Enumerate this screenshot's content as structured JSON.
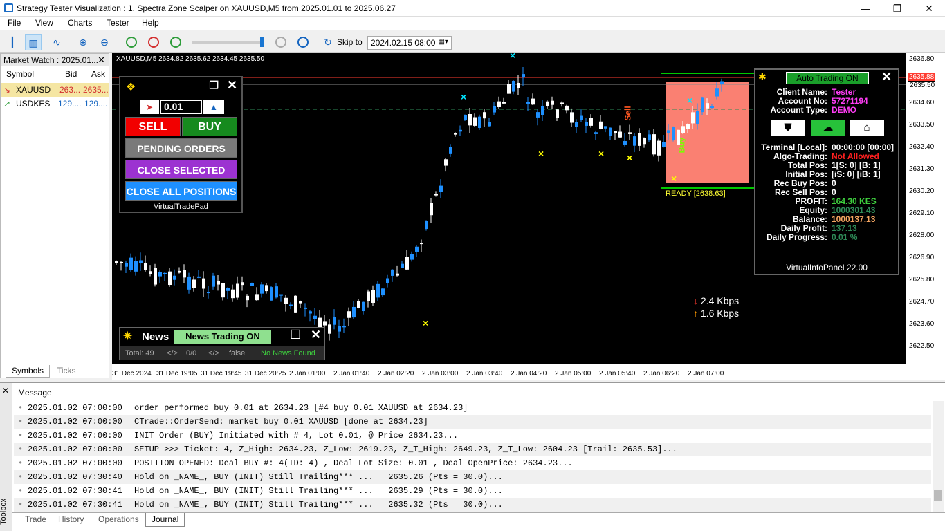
{
  "window": {
    "title": "Strategy Tester Visualization : 1. Spectra Zone Scalper on XAUUSD,M5 from 2025.01.01 to 2025.06.27",
    "min": "—",
    "max": "❐",
    "close": "✕"
  },
  "menu": [
    "File",
    "View",
    "Charts",
    "Tester",
    "Help"
  ],
  "toolbar": {
    "skip_to": "Skip to",
    "date": "2024.02.15 08:00"
  },
  "market_watch": {
    "title": "Market Watch : 2025.01...",
    "columns": [
      "Symbol",
      "Bid",
      "Ask"
    ],
    "rows": [
      {
        "symbol": "XAUUSD",
        "bid": "263...",
        "ask": "2635..."
      },
      {
        "symbol": "USDKES",
        "bid": "129....",
        "ask": "129...."
      }
    ],
    "tabs": [
      "Symbols",
      "Ticks"
    ]
  },
  "chart": {
    "header": "XAUUSD,M5  2634.82 2635.62 2634.45 2635.50",
    "ready": "READY [2638.63]",
    "sell_tag": "Sell",
    "buy_tag": "Buy",
    "net_down": "2.4 Kbps",
    "net_up": "1.6 Kbps",
    "y_ticks": [
      "2636.80",
      "2635.50",
      "2634.60",
      "2633.50",
      "2632.40",
      "2631.30",
      "2630.20",
      "2629.10",
      "2628.00",
      "2626.90",
      "2625.80",
      "2624.70",
      "2623.60",
      "2622.50"
    ],
    "price_tags": [
      "2635.88",
      "2635.50"
    ],
    "x_ticks": [
      "31 Dec 2024",
      "31 Dec 19:05",
      "31 Dec 19:45",
      "31 Dec 20:25",
      "2 Jan 01:00",
      "2 Jan 01:40",
      "2 Jan 02:20",
      "2 Jan 03:00",
      "2 Jan 03:40",
      "2 Jan 04:20",
      "2 Jan 05:00",
      "2 Jan 05:40",
      "2 Jan 06:20",
      "2 Jan 07:00"
    ],
    "colors": {
      "bull": "#1e90ff",
      "bear": "#ffffff",
      "zone": "#fa8072",
      "marker": "#ffff00"
    }
  },
  "vtp": {
    "lot": "0.01",
    "sell": "SELL",
    "buy": "BUY",
    "pending": "PENDING ORDERS",
    "close_selected": "CLOSE SELECTED",
    "close_all": "CLOSE ALL POSITIONS",
    "footer": "VirtualTradePad"
  },
  "vip": {
    "auto": "Auto Trading ON",
    "rows1": [
      {
        "label": "Client Name:",
        "value": "Tester"
      },
      {
        "label": "Account No:",
        "value": "57271194"
      },
      {
        "label": "Account Type:",
        "value": "DEMO"
      }
    ],
    "rows2": [
      {
        "label": "Terminal [Local]:",
        "value": "00:00:00 [00:00]"
      },
      {
        "label": "Algo-Trading:",
        "value": "Not Allowed"
      },
      {
        "label": "Total Pos:",
        "value": "1[S: 0] [B: 1]"
      },
      {
        "label": "Initial Pos:",
        "value": "[iS: 0] [iB: 1]"
      },
      {
        "label": "Rec Buy Pos:",
        "value": "0"
      },
      {
        "label": "Rec Sell Pos:",
        "value": "0"
      },
      {
        "label": "PROFIT:",
        "value": "164.30 KES"
      },
      {
        "label": "Equity:",
        "value": "1000301.43"
      },
      {
        "label": "Balance:",
        "value": "1000137.13"
      },
      {
        "label": "Daily Profit:",
        "value": "137.13"
      },
      {
        "label": "Daily Progress:",
        "value": "0.01 %"
      }
    ],
    "footer": "VirtualInfoPanel 22.00"
  },
  "news": {
    "title": "News",
    "status": "News Trading ON",
    "total": "Total: 49",
    "s1": "</>",
    "s2": "0/0",
    "s3": "</>",
    "s4": "false",
    "found": "No News Found"
  },
  "journal": {
    "header": "Message",
    "rows": [
      {
        "time": "2025.01.02 07:00:00",
        "msg": "order performed buy 0.01 at 2634.23 [#4 buy 0.01 XAUUSD at 2634.23]"
      },
      {
        "time": "2025.01.02 07:00:00",
        "msg": "CTrade::OrderSend: market buy 0.01 XAUUSD [done at 2634.23]"
      },
      {
        "time": "2025.01.02 07:00:00",
        "msg": "INIT Order (BUY) Initiated with # 4, Lot 0.01, @ Price 2634.23..."
      },
      {
        "time": "2025.01.02 07:00:00",
        "msg": "SETUP >>> Ticket: 4, Z_High: 2634.23, Z_Low: 2619.23, Z_T_High: 2649.23, Z_T_Low: 2604.23 [Trail: 2635.53]..."
      },
      {
        "time": "2025.01.02 07:00:00",
        "msg": "POSITION OPENED: Deal BUY #: 4(ID: 4) , Deal Lot Size: 0.01 , Deal OpenPrice: 2634.23..."
      },
      {
        "time": "2025.01.02 07:30:40",
        "msg": "Hold on _NAME_, BUY (INIT) Still Trailing*** ...   2635.26 (Pts = 30.0)..."
      },
      {
        "time": "2025.01.02 07:30:41",
        "msg": "Hold on _NAME_, BUY (INIT) Still Trailing*** ...   2635.29 (Pts = 30.0)..."
      },
      {
        "time": "2025.01.02 07:30:41",
        "msg": "Hold on _NAME_, BUY (INIT) Still Trailing*** ...   2635.32 (Pts = 30.0)..."
      }
    ],
    "tabs": [
      "Trade",
      "History",
      "Operations",
      "Journal"
    ],
    "side": "Toolbox"
  }
}
